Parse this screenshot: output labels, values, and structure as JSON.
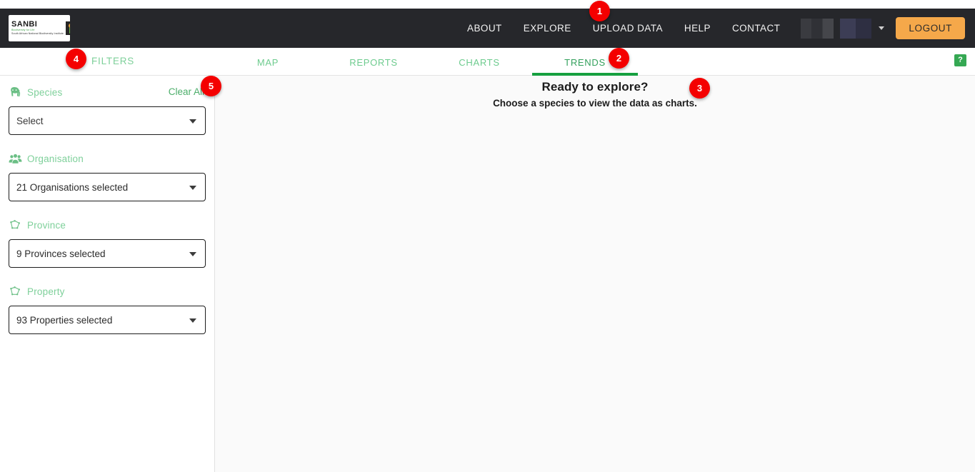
{
  "header": {
    "logo": {
      "name": "SANBI",
      "tagline": "Biodiversity for Life",
      "full_name": "South African National Biodiversity Institute"
    },
    "nav": [
      {
        "label": "ABOUT",
        "name": "nav-about"
      },
      {
        "label": "EXPLORE",
        "name": "nav-explore"
      },
      {
        "label": "UPLOAD DATA",
        "name": "nav-upload-data"
      },
      {
        "label": "HELP",
        "name": "nav-help"
      },
      {
        "label": "CONTACT",
        "name": "nav-contact"
      }
    ],
    "user_menu": {
      "label": "",
      "redacted": true
    },
    "logout_label": "LOGOUT",
    "background_color": "#26272b",
    "logout_color": "#f5a84a"
  },
  "subbar": {
    "filters_title": "FILTERS",
    "help_label": "?",
    "tabs": [
      {
        "label": "MAP",
        "name": "tab-map",
        "active": false
      },
      {
        "label": "REPORTS",
        "name": "tab-reports",
        "active": false
      },
      {
        "label": "CHARTS",
        "name": "tab-charts",
        "active": false
      },
      {
        "label": "TRENDS",
        "name": "tab-trends",
        "active": true
      }
    ],
    "active_tab": "TRENDS",
    "accent_color": "#16a03f"
  },
  "sidebar": {
    "clear_all_label": "Clear All",
    "filters": [
      {
        "label": "Species",
        "icon": "elephant-icon",
        "value": "Select",
        "is_placeholder": true,
        "name": "species"
      },
      {
        "label": "Organisation",
        "icon": "people-group-icon",
        "value": "21 Organisations selected",
        "is_placeholder": false,
        "name": "organisation"
      },
      {
        "label": "Province",
        "icon": "polygon-icon",
        "value": "9 Provinces selected",
        "is_placeholder": false,
        "name": "province"
      },
      {
        "label": "Property",
        "icon": "polygon-icon",
        "value": "93 Properties selected",
        "is_placeholder": false,
        "name": "property"
      }
    ]
  },
  "main": {
    "empty_title": "Ready to explore?",
    "empty_subtitle": "Choose a species to view the data as charts."
  },
  "markers": [
    {
      "id": "1",
      "target": "nav-explore"
    },
    {
      "id": "2",
      "target": "tab-trends"
    },
    {
      "id": "3",
      "target": "empty-state"
    },
    {
      "id": "4",
      "target": "filters-title"
    },
    {
      "id": "5",
      "target": "clear-all"
    }
  ]
}
